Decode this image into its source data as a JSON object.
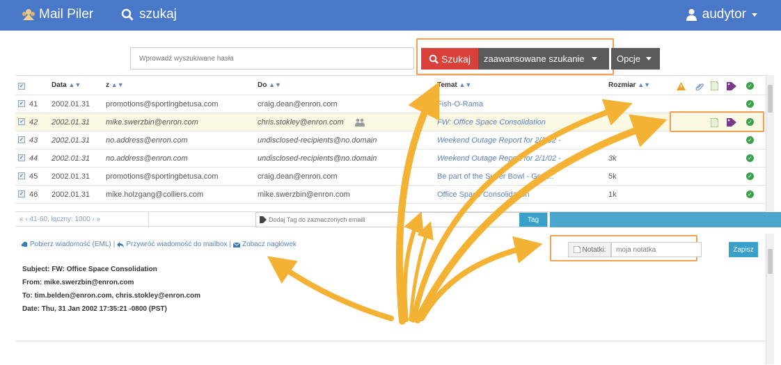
{
  "topbar": {
    "brand": "Mail Piler",
    "search_link": "szukaj",
    "user": "audytor"
  },
  "search": {
    "placeholder": "Wprowadź wyszukiwane hasła",
    "search_button": "Szukaj",
    "advanced_button": "zaawansowane szukanie",
    "options_button": "Opcje"
  },
  "table": {
    "headers": {
      "date": "Data",
      "from": "z",
      "to": "Do",
      "subject": "Temat",
      "size": "Rozmiar"
    },
    "rows": [
      {
        "num": "41",
        "date": "2002.01.31",
        "from": "promotions@sportingbetusa.com",
        "to": "craig.dean@enron.com",
        "subject": "Fish-O-Rama",
        "size": "5k"
      },
      {
        "num": "42",
        "date": "2002.01.31",
        "from": "mike.swerzbin@enron.com",
        "to": "chris.stokley@enron.com",
        "subject": "FW: Office Space Consolidation",
        "size": ""
      },
      {
        "num": "43",
        "date": "2002.01.31",
        "from": "no.address@enron.com",
        "to": "undisclosed-recipients@no.domain",
        "subject": "Weekend Outage Report for 2/1/02 -",
        "size": "3k"
      },
      {
        "num": "44",
        "date": "2002.01.31",
        "from": "no.address@enron.com",
        "to": "undisclosed-recipients@no.domain",
        "subject": "Weekend Outage Report for 2/1/02 -",
        "size": "3k"
      },
      {
        "num": "45",
        "date": "2002.01.31",
        "from": "promotions@sportingbetusa.com",
        "to": "craig.dean@enron.com",
        "subject": "Be part of the Super Bowl - Get i...",
        "size": "5k"
      },
      {
        "num": "46",
        "date": "2002.01.31",
        "from": "mike.holzgang@colliers.com",
        "to": "mike.swerzbin@enron.com",
        "subject": "Office Space Consolidation",
        "size": "1k"
      }
    ]
  },
  "pager": {
    "text": "«  ‹  41-60, łączny: 1000  ›  »",
    "tag_placeholder": "Dodaj Tag do zaznaczonych emaili",
    "tag_button": "Tag"
  },
  "preview": {
    "download": "Pobierz wiadomość (EML)",
    "restore": "Przywróć wiadomość do mailbox",
    "headers_link": "Zobacz nagłówek",
    "note_label": "Notatki:",
    "note_value": "moja notatka",
    "save_button": "Zapisz",
    "subject": "Subject: FW: Office Space Consolidation",
    "from": "From: mike.swerzbin@enron.com",
    "to": "To: tim.belden@enron.com, chris.stokley@enron.com",
    "date": "Date: Thu, 31 Jan 2002 17:35:21 -0800 (PST)"
  },
  "colors": {
    "topbar": "#4a78c8",
    "highlight": "#f0a050",
    "arrow": "#f3b233",
    "search_red": "#d9403a",
    "action_blue": "#39a1c9",
    "ok_green": "#3aa24b"
  }
}
